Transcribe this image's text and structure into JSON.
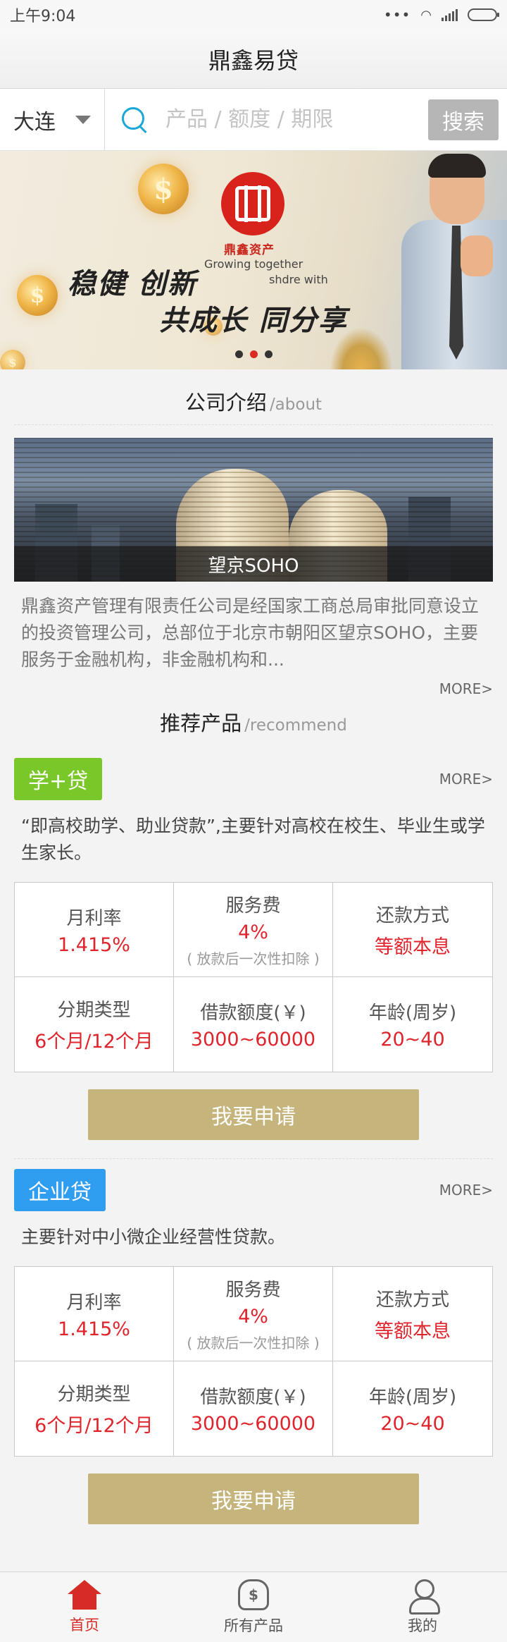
{
  "status_bar": {
    "time": "上午9:04"
  },
  "header": {
    "title": "鼎鑫易贷"
  },
  "search": {
    "city": "大连",
    "placeholder": "产品 / 额度 / 期限",
    "button": "搜索"
  },
  "banner": {
    "logo_name": "鼎鑫资产",
    "slogan_en_1": "Growing together",
    "slogan_en_2": "shdre with",
    "slogan_line1": "稳健 创新",
    "slogan_line2": "共成长 同分享",
    "active_slide": 2,
    "slide_count": 3
  },
  "about": {
    "title": "公司介绍",
    "subtitle": "/about",
    "image_caption": "望京SOHO",
    "text": "鼎鑫资产管理有限责任公司是经国家工商总局审批同意设立的投资管理公司，总部位于北京市朝阳区望京SOHO，主要服务于金融机构，非金融机构和...",
    "more": "MORE>"
  },
  "recommend": {
    "title": "推荐产品",
    "subtitle": "/recommend"
  },
  "products": [
    {
      "tag": "学+贷",
      "tag_color": "#7ac72a",
      "more": "MORE>",
      "desc": "“即高校助学、助业贷款”,主要针对高校在校生、毕业生或学生家长。",
      "cells": [
        {
          "label": "月利率",
          "value": "1.415%"
        },
        {
          "label": "服务费",
          "value": "4%",
          "note": "( 放款后一次性扣除 )"
        },
        {
          "label": "还款方式",
          "value": "等额本息"
        },
        {
          "label": "分期类型",
          "value": "6个月/12个月"
        },
        {
          "label": "借款额度(￥)",
          "value": "3000~60000"
        },
        {
          "label": "年龄(周岁)",
          "value": "20~40"
        }
      ],
      "apply": "我要申请"
    },
    {
      "tag": "企业贷",
      "tag_color": "#2f9df0",
      "more": "MORE>",
      "desc": "主要针对中小微企业经营性贷款。",
      "cells": [
        {
          "label": "月利率",
          "value": "1.415%"
        },
        {
          "label": "服务费",
          "value": "4%",
          "note": "( 放款后一次性扣除 )"
        },
        {
          "label": "还款方式",
          "value": "等额本息"
        },
        {
          "label": "分期类型",
          "value": "6个月/12个月"
        },
        {
          "label": "借款额度(￥)",
          "value": "3000~60000"
        },
        {
          "label": "年龄(周岁)",
          "value": "20~40"
        }
      ],
      "apply": "我要申请"
    }
  ],
  "tabbar": {
    "items": [
      {
        "label": "首页",
        "icon": "home-icon",
        "active": true
      },
      {
        "label": "所有产品",
        "icon": "money-bag-icon",
        "active": false
      },
      {
        "label": "我的",
        "icon": "user-icon",
        "active": false
      }
    ]
  },
  "colors": {
    "accent_red": "#e0242c",
    "apply_gold": "#c5b47c",
    "search_blue": "#19a8d8"
  }
}
